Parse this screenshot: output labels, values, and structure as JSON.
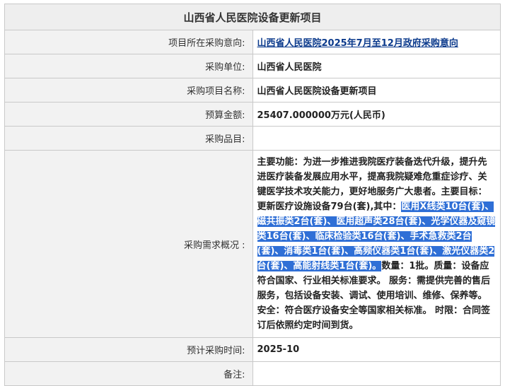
{
  "title": "山西省人民医院设备更新项目",
  "rows": {
    "intent_label": "项目所在采购意向:",
    "intent_value": "山西省人民医院2025年7月至12月政府采购意向",
    "unit_label": "采购单位:",
    "unit_value": "山西省人民医院",
    "project_label": "采购项目名称:",
    "project_value": "山西省人民医院设备更新项目",
    "budget_label": "预算金额:",
    "budget_value": "25407.000000万元(人民币)",
    "items_label": "采购品目:",
    "items_value": "",
    "summary_label": "采购需求概况 :",
    "summary_before": "主要功能：为进一步推进我院医疗装备迭代升级，提升先进医疗装备发展应用水平，提高我院疑难危重症诊疗、关键医学技术攻关能力，更好地服务广大患者。主要目标：更新医疗设施设备79台(套),其中：",
    "summary_selected": "医用X线类10台(套)、磁共振类2台(套)、医用超声类28台(套)、光学仪器及窥镜类16台(套)、临床检验类16台(套)、手术急救类2台(套)、消毒类1台(套)、高频仪器类1台(套)、激光仪器类2台(套)、高能射线类1台(套)。",
    "summary_after": "数量：1批。质量：设备应符合国家、行业相关标准要求。 服务：需提供完善的售后服务，包括设备安装、调试、使用培训、维修、保养等。 安全：符合医疗设备安全等国家相关标准。 时限：合同签订后依照约定时间到货。",
    "time_label": "预计采购时间:",
    "time_value": "2025-10",
    "note_label": "备注:",
    "note_value": ""
  },
  "colors": {
    "selection": "#2f6fd6",
    "link": "#0b3a8c"
  }
}
